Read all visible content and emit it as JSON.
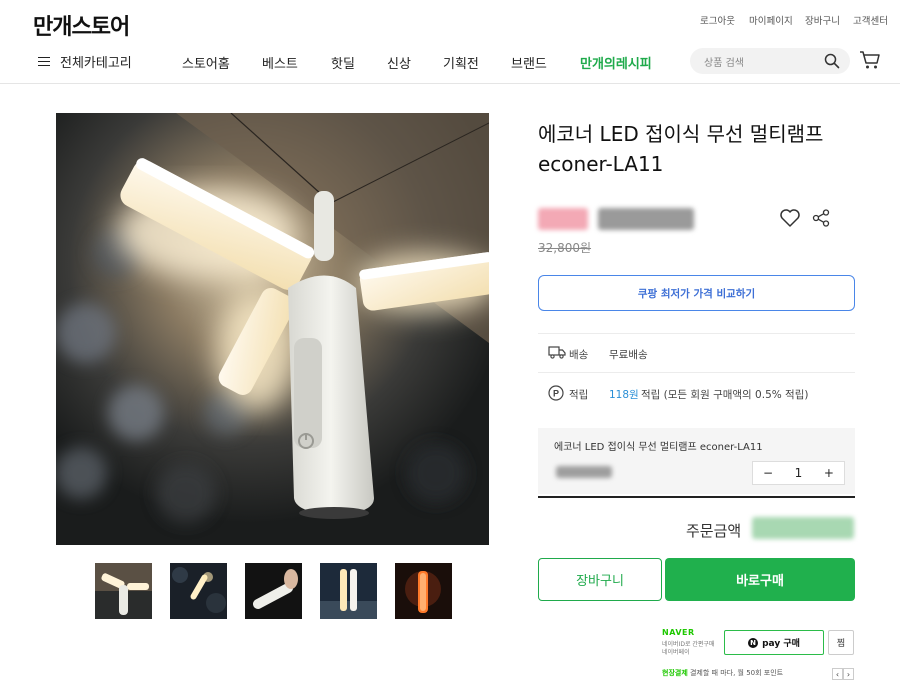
{
  "header": {
    "logo": "만개스토어",
    "util_links": [
      "로그아웃",
      "마이페이지",
      "장바구니",
      "고객센터"
    ],
    "category_label": "전체카테고리",
    "nav_items": [
      "스토어홈",
      "베스트",
      "핫딜",
      "신상",
      "기획전",
      "브랜드"
    ],
    "nav_special": "만개의레시피",
    "search_placeholder": "상품 검색",
    "accent_green": "#1faa4b"
  },
  "product": {
    "title": "에코너 LED 접이식 무선 멀티램프 econer-LA11",
    "original_price": "32,800원",
    "compare_button": "쿠팡 최저가 가격 비교하기",
    "shipping_label": "배송",
    "shipping_value": "무료배송",
    "points_label": "적립",
    "points_amount": "118원",
    "points_rest": "적립 (모든 회원 구매액의 0.5% 적립)",
    "option_name": "에코너 LED 접이식 무선 멀티램프 econer-LA11",
    "quantity": "1",
    "minus": "−",
    "plus": "+",
    "order_label": "주문금액",
    "cart_button": "장바구니",
    "buy_button": "바로구매"
  },
  "naverpay": {
    "brand": "NAVER",
    "sub1": "네이버ID로 간편구매",
    "sub2": "네이버페이",
    "pay_label": "pay 구매",
    "pay_n": "N",
    "jjim": "찜",
    "notice_highlight": "현장결제",
    "notice_text": " 결제할 때 마다, 월 50회 포인트",
    "prev": "‹",
    "next": "›"
  },
  "icons": [
    "hamburger-icon",
    "search-icon",
    "cart-icon",
    "heart-icon",
    "share-icon",
    "truck-icon",
    "points-icon"
  ]
}
